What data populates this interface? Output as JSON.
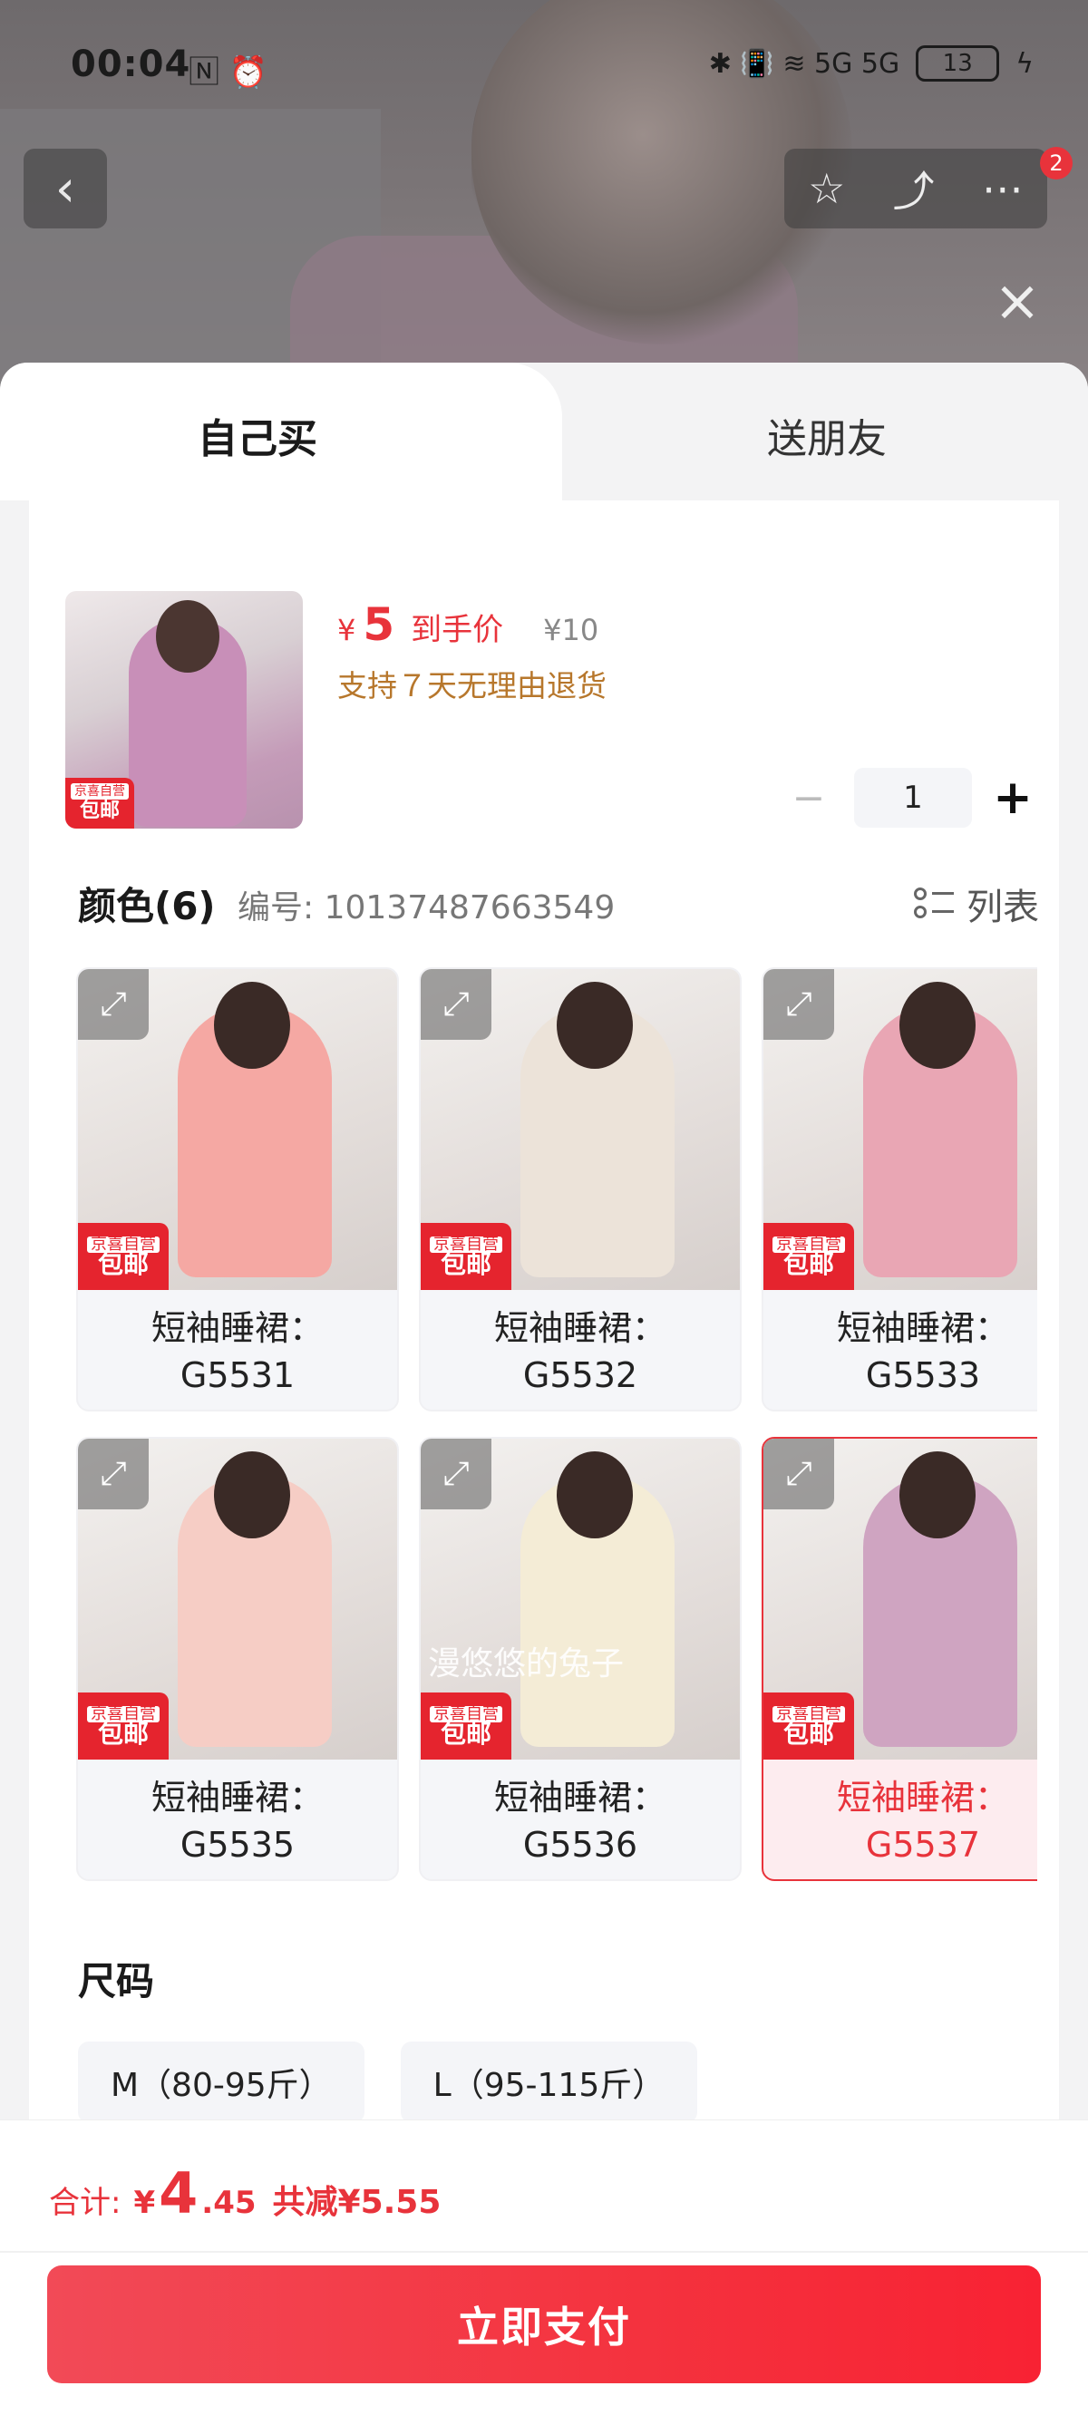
{
  "status_bar": {
    "time": "00:04",
    "left_icons": "🄽 ⏰",
    "right_icons": "✱ 📳 ≋ 5G 5G",
    "battery": "13"
  },
  "nav": {
    "back_icon": "chevron-left-icon",
    "badge_count": "2"
  },
  "tabs": {
    "self_label": "自己买",
    "gift_label": "送朋友"
  },
  "product": {
    "currency": "¥",
    "price": "5",
    "price_label": "到手价",
    "original_price": "¥10",
    "returns_text": "支持７天无理由退货",
    "tag_line1": "京喜自营",
    "tag_line2": "包邮"
  },
  "stepper": {
    "minus": "−",
    "quantity": "1",
    "plus": "+"
  },
  "color_section": {
    "title": "颜色(6)",
    "code": "编号: 10137487663549",
    "view_label": "列表",
    "watermark": "漫悠悠的兔子",
    "options": [
      {
        "name": "短袖睡裙：G5531",
        "color": "#f5a8a3",
        "selected": false
      },
      {
        "name": "短袖睡裙：G5532",
        "color": "#ece3d9",
        "selected": false
      },
      {
        "name": "短袖睡裙：G5533",
        "color": "#e9a6b4",
        "selected": false
      },
      {
        "name": "短袖睡裙：G5535",
        "color": "#f6cdc5",
        "selected": false
      },
      {
        "name": "短袖睡裙：G5536",
        "color": "#f4ecd6",
        "selected": false
      },
      {
        "name": "短袖睡裙：G5537",
        "color": "#cfa4c1",
        "selected": true
      }
    ]
  },
  "size_section": {
    "title": "尺码",
    "options": [
      "M（80-95斤）",
      "L（95-115斤）"
    ]
  },
  "footer": {
    "total_label": "合计:",
    "currency": "¥",
    "total_int": "4",
    "total_dec": ".45",
    "discount": "共减¥5.55",
    "pay_label": "立即支付"
  },
  "colors": {
    "accent_red": "#e8333b",
    "returns_gold": "#b7772c"
  }
}
